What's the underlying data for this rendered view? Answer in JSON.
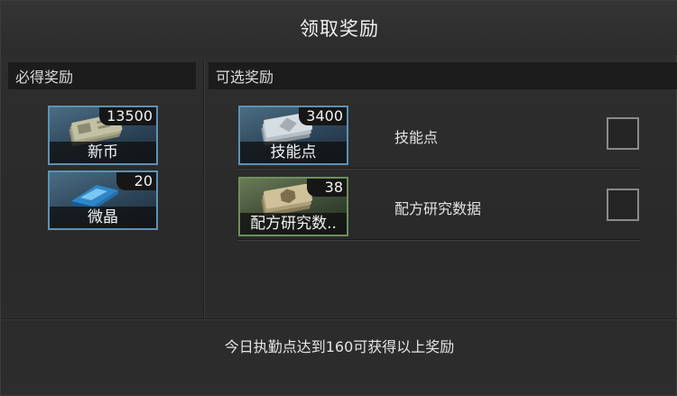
{
  "dialog": {
    "title": "领取奖励"
  },
  "left_section": {
    "header": "必得奖励",
    "items": [
      {
        "name": "新币",
        "count": "13500",
        "icon": "banknotes-icon"
      },
      {
        "name": "微晶",
        "count": "20",
        "icon": "crystal-icon"
      }
    ]
  },
  "right_section": {
    "header": "可选奖励",
    "options": [
      {
        "card_name": "技能点",
        "count": "3400",
        "label": "技能点",
        "icon": "skill-point-icon",
        "checked": false
      },
      {
        "card_name": "配方研究数..",
        "count": "38",
        "label": "配方研究数据",
        "icon": "recipe-data-icon",
        "checked": false
      }
    ]
  },
  "footer": {
    "message": "今日执勤点达到160可获得以上奖励"
  },
  "colors": {
    "blue_frame": "#5b92b6",
    "green_frame": "#6e8f5d",
    "background": "#2b2b2b"
  }
}
